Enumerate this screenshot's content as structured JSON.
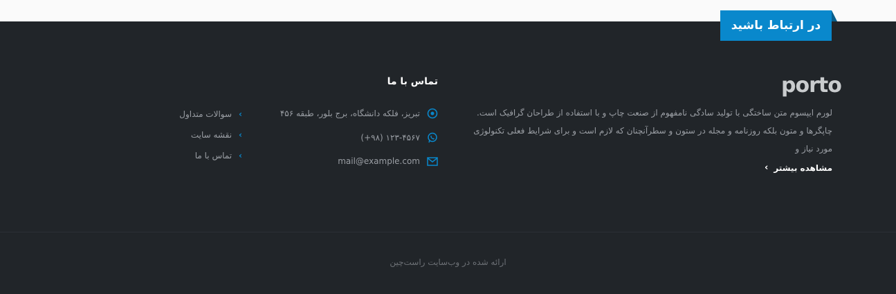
{
  "ribbon": {
    "label": "در ارتباط باشید"
  },
  "logo": {
    "text": "porto"
  },
  "about": {
    "text": "لورم ایپسوم متن ساختگی با تولید سادگی نامفهوم از صنعت چاپ و با استفاده از طراحان گرافیک است. چاپگرها و متون بلکه روزنامه و مجله در ستون و سطرآنچنان که لازم است و برای شرایط فعلی تکنولوژی مورد نیاز و",
    "more_label": "مشاهده بیشتر"
  },
  "contact": {
    "title": "تماس با ما",
    "address": "تبریز، فلکه دانشگاه، برج بلور، طبقه ۴۵۶",
    "phone": "(+۹۸) ۱۲۳-۴۵۶۷",
    "email": "mail@example.com"
  },
  "links": [
    {
      "label": "سوالات متداول"
    },
    {
      "label": "نقشه سایت"
    },
    {
      "label": "تماس با ما"
    }
  ],
  "copyright": "ارائه شده در وب‌سایت راست‌چین",
  "colors": {
    "accent": "#0988cc",
    "footer_bg": "#212529",
    "text_muted": "#9a9ea4"
  }
}
